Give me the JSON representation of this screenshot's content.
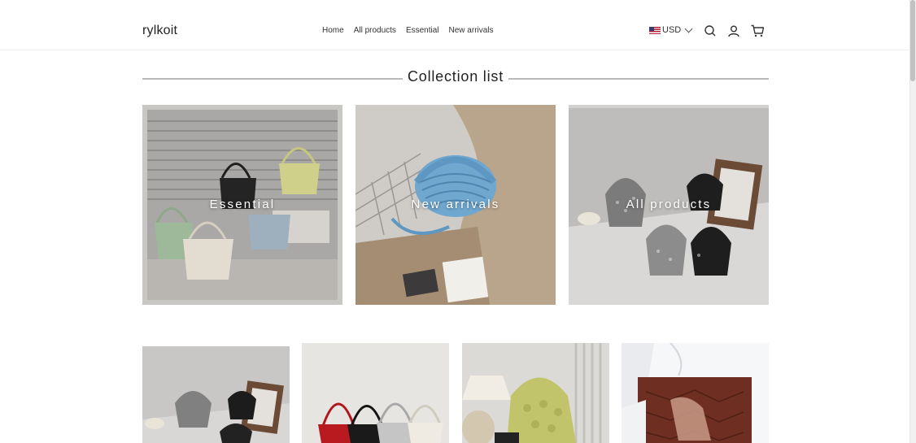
{
  "header": {
    "logo": "rylkoit",
    "nav": [
      "Home",
      "All products",
      "Essential",
      "New arrivals"
    ],
    "currency": "USD"
  },
  "section": {
    "title": "Collection list"
  },
  "collections": [
    {
      "label": "Essential"
    },
    {
      "label": "New arrivals"
    },
    {
      "label": "All products"
    }
  ],
  "icons": {
    "search": "search-icon",
    "account": "user-icon",
    "cart": "cart-icon",
    "currency": "us-flag-icon"
  }
}
